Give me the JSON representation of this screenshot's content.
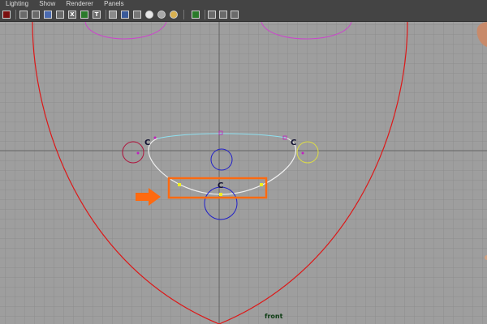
{
  "menu": [
    "Lighting",
    "Show",
    "Renderer",
    "Panels"
  ],
  "toolbar": {
    "icons": [
      "select-tool-icon",
      "wireframe-icon",
      "smooth-shade-icon",
      "flat-shade-icon",
      "bounding-box-icon",
      "xray-icon",
      "texture-icon",
      "cube-icon",
      "cube-solid-icon",
      "cube-checker-icon",
      "light-sphere-icon",
      "shaded-sphere-icon",
      "textured-sphere-icon",
      "isolate-select-icon",
      "grid-toggle-icon",
      "camera-cube-icon",
      "node-graph-icon"
    ],
    "glyph_texture": "T",
    "glyph_xray": "X"
  },
  "viewport": {
    "camera_label": "front",
    "curve_labels": [
      "C",
      "C",
      "C"
    ],
    "colors": {
      "grid_bg": "#9e9e9e",
      "grid_line": "#8a8a8a",
      "grid_axis": "#555555",
      "head_outline": "#dd1818",
      "mouth_curve": "#f0f0f0",
      "mouth_curve_top": "#8fe0f0",
      "eye_curve": "#cc44cc",
      "left_control": "#b0103a",
      "right_control": "#e0e040",
      "center_control": "#2020c8",
      "highlight": "#ff6a10",
      "arrow": "#ff6a10"
    }
  }
}
